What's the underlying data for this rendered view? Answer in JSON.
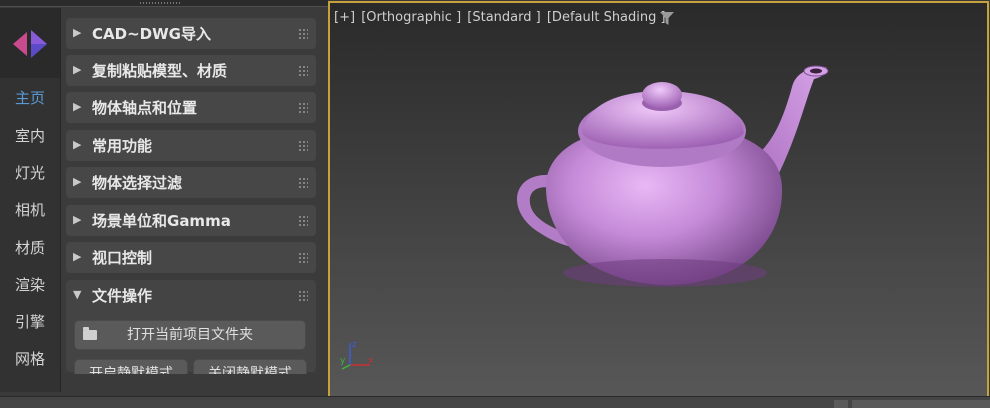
{
  "rail": {
    "items": [
      {
        "label": "主页",
        "active": true
      },
      {
        "label": "室内"
      },
      {
        "label": "灯光"
      },
      {
        "label": "相机"
      },
      {
        "label": "材质"
      },
      {
        "label": "渲染"
      },
      {
        "label": "引擎"
      },
      {
        "label": "网格"
      }
    ]
  },
  "panel": {
    "sections": [
      {
        "title": "CAD~DWG导入",
        "expanded": false
      },
      {
        "title": "复制粘贴模型、材质",
        "expanded": false
      },
      {
        "title": "物体轴点和位置",
        "expanded": false
      },
      {
        "title": "常用功能",
        "expanded": false
      },
      {
        "title": "物体选择过滤",
        "expanded": false
      },
      {
        "title": "场景单位和Gamma",
        "expanded": false
      },
      {
        "title": "视口控制",
        "expanded": false
      },
      {
        "title": "文件操作",
        "expanded": true
      }
    ],
    "file_ops": {
      "open_folder": "打开当前项目文件夹",
      "enable_silent": "开启静默模式",
      "disable_silent": "关闭静默模式"
    }
  },
  "viewport": {
    "label_plus": "[+]",
    "label_view": "[Orthographic ]",
    "label_preset": "[Standard ]",
    "label_shading": "[Default Shading ]",
    "border_color": "#c7a23c",
    "teapot_color": "#c58ad8"
  },
  "gizmo": {
    "x": "x",
    "y": "y",
    "z": "z"
  },
  "colors": {
    "active": "#5b9bd5"
  }
}
